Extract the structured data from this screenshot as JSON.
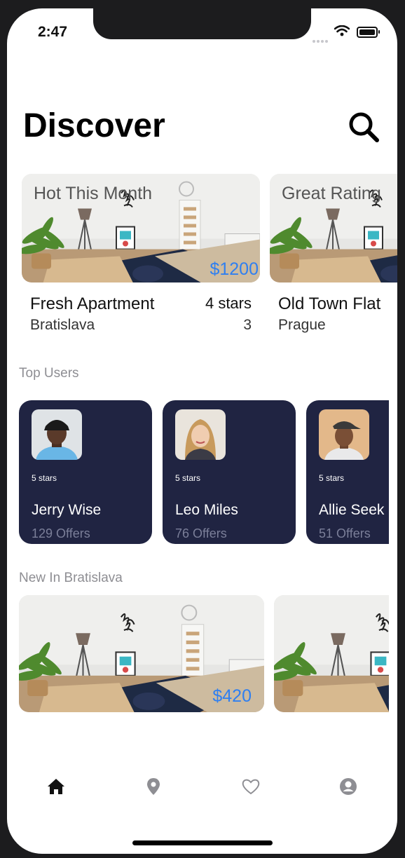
{
  "status_bar": {
    "time": "2:47"
  },
  "header": {
    "title": "Discover"
  },
  "featured": [
    {
      "tag": "Hot This Month",
      "price": "$1200",
      "name": "Fresh Apartment",
      "rating": "4 stars",
      "city": "Bratislava",
      "count": "3"
    },
    {
      "tag": "Great Rating",
      "price": "",
      "name": "Old Town Flat",
      "rating": "",
      "city": "Prague",
      "count": ""
    }
  ],
  "top_users": {
    "title": "Top Users",
    "users": [
      {
        "stars": "5 stars",
        "name": "Jerry Wise",
        "offers": "129 Offers"
      },
      {
        "stars": "5 stars",
        "name": "Leo Miles",
        "offers": "76 Offers"
      },
      {
        "stars": "5 stars",
        "name": "Allie Seek",
        "offers": "51 Offers"
      }
    ]
  },
  "new_in": {
    "title": "New In Bratislava",
    "listings": [
      {
        "price": "$420"
      },
      {
        "price": ""
      }
    ]
  },
  "tab_bar": [
    "home-icon",
    "location-pin-icon",
    "heart-icon",
    "profile-icon"
  ],
  "colors": {
    "accent_price": "#2f7ff0",
    "user_card_bg": "#202442",
    "offers_text": "#7b7f99",
    "section_title": "#8e8e93"
  }
}
